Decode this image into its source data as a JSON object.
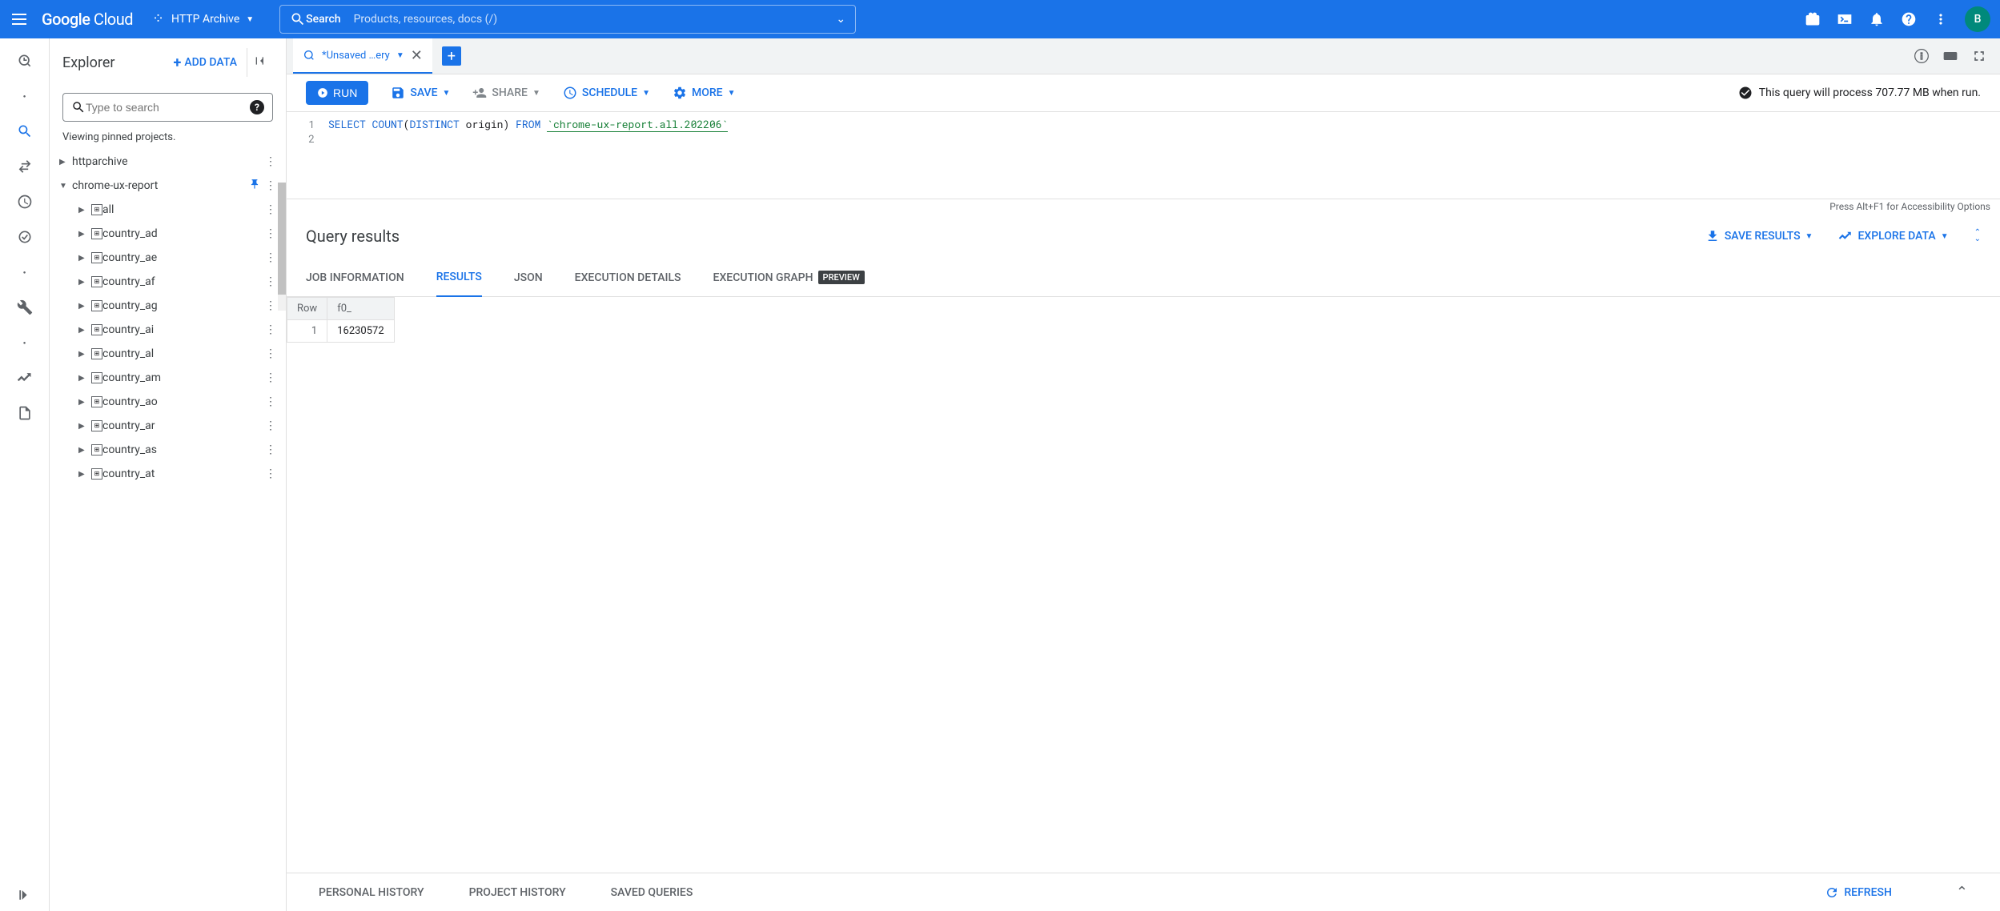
{
  "header": {
    "logo_html": "Google Cloud",
    "project": "HTTP Archive",
    "search_label": "Search",
    "search_placeholder": "Products, resources, docs (/)",
    "avatar_letter": "B"
  },
  "explorer": {
    "title": "Explorer",
    "add_data": "ADD DATA",
    "search_placeholder": "Type to search",
    "pinned_text": "Viewing pinned projects.",
    "projects": [
      {
        "name": "httparchive",
        "expanded": false,
        "pinned": false
      },
      {
        "name": "chrome-ux-report",
        "expanded": true,
        "pinned": true
      }
    ],
    "datasets": [
      "all",
      "country_ad",
      "country_ae",
      "country_af",
      "country_ag",
      "country_ai",
      "country_al",
      "country_am",
      "country_ao",
      "country_ar",
      "country_as",
      "country_at"
    ]
  },
  "tabs": {
    "active_label": "*Unsaved …ery"
  },
  "toolbar": {
    "run": "RUN",
    "save": "SAVE",
    "share": "SHARE",
    "schedule": "SCHEDULE",
    "more": "MORE",
    "status": "This query will process 707.77 MB when run."
  },
  "editor": {
    "lines": [
      "1",
      "2"
    ],
    "sql_select": "SELECT",
    "sql_count": "COUNT",
    "sql_distinct": "DISTINCT",
    "sql_origin": " origin)",
    "sql_from": "FROM",
    "sql_table": "`chrome-ux-report.all.202206`",
    "footer": "Press Alt+F1 for Accessibility Options"
  },
  "results": {
    "title": "Query results",
    "save_results": "SAVE RESULTS",
    "explore_data": "EXPLORE DATA",
    "tabs": {
      "job": "JOB INFORMATION",
      "results": "RESULTS",
      "json": "JSON",
      "exec": "EXECUTION DETAILS",
      "graph": "EXECUTION GRAPH",
      "preview_badge": "PREVIEW"
    },
    "columns": [
      "Row",
      "f0_"
    ],
    "rows": [
      {
        "row": "1",
        "f0": "16230572"
      }
    ]
  },
  "history": {
    "personal": "PERSONAL HISTORY",
    "project": "PROJECT HISTORY",
    "saved": "SAVED QUERIES",
    "refresh": "REFRESH"
  }
}
